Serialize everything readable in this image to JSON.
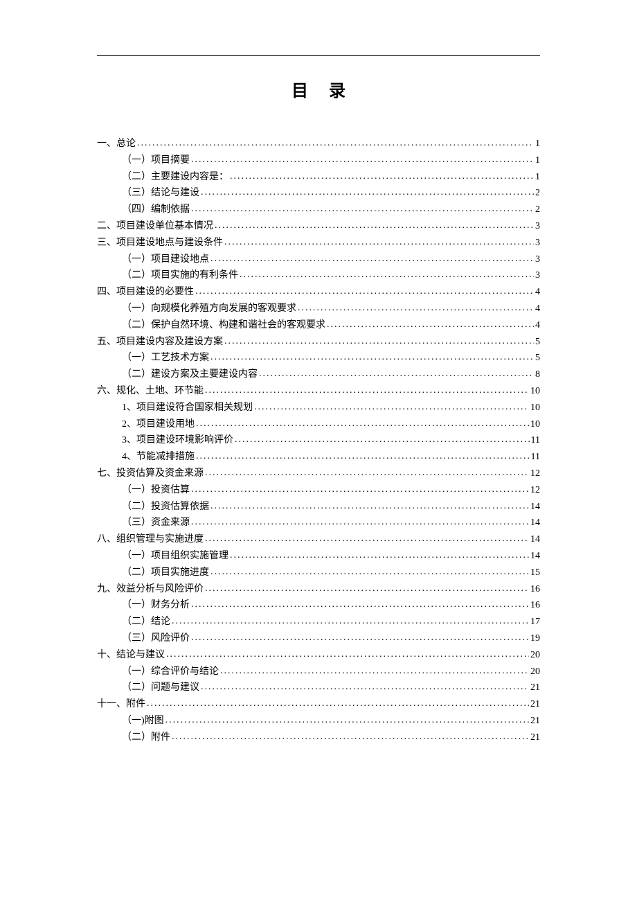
{
  "document": {
    "title": "目录"
  },
  "toc": [
    {
      "level": 1,
      "label": "一、总论",
      "page": "1"
    },
    {
      "level": 2,
      "label": "（一）项目摘要",
      "page": "1"
    },
    {
      "level": 2,
      "label": "（二）主要建设内容是：",
      "page": "1"
    },
    {
      "level": 2,
      "label": "（三）结论与建设",
      "page": "2"
    },
    {
      "level": 2,
      "label": "（四）编制依据",
      "page": "2"
    },
    {
      "level": 1,
      "label": "二、项目建设单位基本情况",
      "page": "3"
    },
    {
      "level": 1,
      "label": "三、项目建设地点与建设条件",
      "page": "3"
    },
    {
      "level": 2,
      "label": "（一）项目建设地点",
      "page": "3"
    },
    {
      "level": 2,
      "label": "（二）项目实施的有利条件",
      "page": "3"
    },
    {
      "level": 1,
      "label": "四、项目建设的必要性",
      "page": "4"
    },
    {
      "level": 2,
      "label": "（一）向规模化养殖方向发展的客观要求",
      "page": "4"
    },
    {
      "level": 2,
      "label": "（二）保护自然环境、构建和谐社会的客观要求",
      "page": "4"
    },
    {
      "level": 1,
      "label": "五、项目建设内容及建设方案",
      "page": "5"
    },
    {
      "level": 2,
      "label": "（一）工艺技术方案",
      "page": "5"
    },
    {
      "level": 2,
      "label": "（二）建设方案及主要建设内容",
      "page": "8"
    },
    {
      "level": 1,
      "label": "六、规化、土地、环节能",
      "page": "10"
    },
    {
      "level": 2,
      "label": "1、项目建设符合国家相关规划",
      "page": "10"
    },
    {
      "level": 2,
      "label": "2、项目建设用地",
      "page": "10"
    },
    {
      "level": 2,
      "label": "3、项目建设环境影响评价",
      "page": "11"
    },
    {
      "level": 2,
      "label": "4、节能减排措施",
      "page": "11"
    },
    {
      "level": 1,
      "label": "七、投资估算及资金来源",
      "page": "12"
    },
    {
      "level": 2,
      "label": "（一）投资估算",
      "page": "12"
    },
    {
      "level": 2,
      "label": "（二）投资估算依据",
      "page": "14"
    },
    {
      "level": 2,
      "label": "（三）资金来源",
      "page": "14"
    },
    {
      "level": 1,
      "label": "八、组织管理与实施进度",
      "page": "14"
    },
    {
      "level": 2,
      "label": "（一）项目组织实施管理",
      "page": "14"
    },
    {
      "level": 2,
      "label": "（二）项目实施进度",
      "page": "15"
    },
    {
      "level": 1,
      "label": "九、效益分析与风险评价",
      "page": "16"
    },
    {
      "level": 2,
      "label": "（一）财务分析",
      "page": "16"
    },
    {
      "level": 2,
      "label": "（二）结论",
      "page": "17"
    },
    {
      "level": 2,
      "label": "（三）风险评价",
      "page": "19"
    },
    {
      "level": 1,
      "label": "十、结论与建议",
      "page": "20"
    },
    {
      "level": 2,
      "label": "（一）综合评价与结论",
      "page": "20"
    },
    {
      "level": 2,
      "label": "（二）问题与建议",
      "page": "21"
    },
    {
      "level": 1,
      "label": "十一、附件",
      "page": "21"
    },
    {
      "level": 2,
      "label": "（一)附图",
      "page": "21"
    },
    {
      "level": 2,
      "label": "（二）附件",
      "page": "21"
    }
  ]
}
